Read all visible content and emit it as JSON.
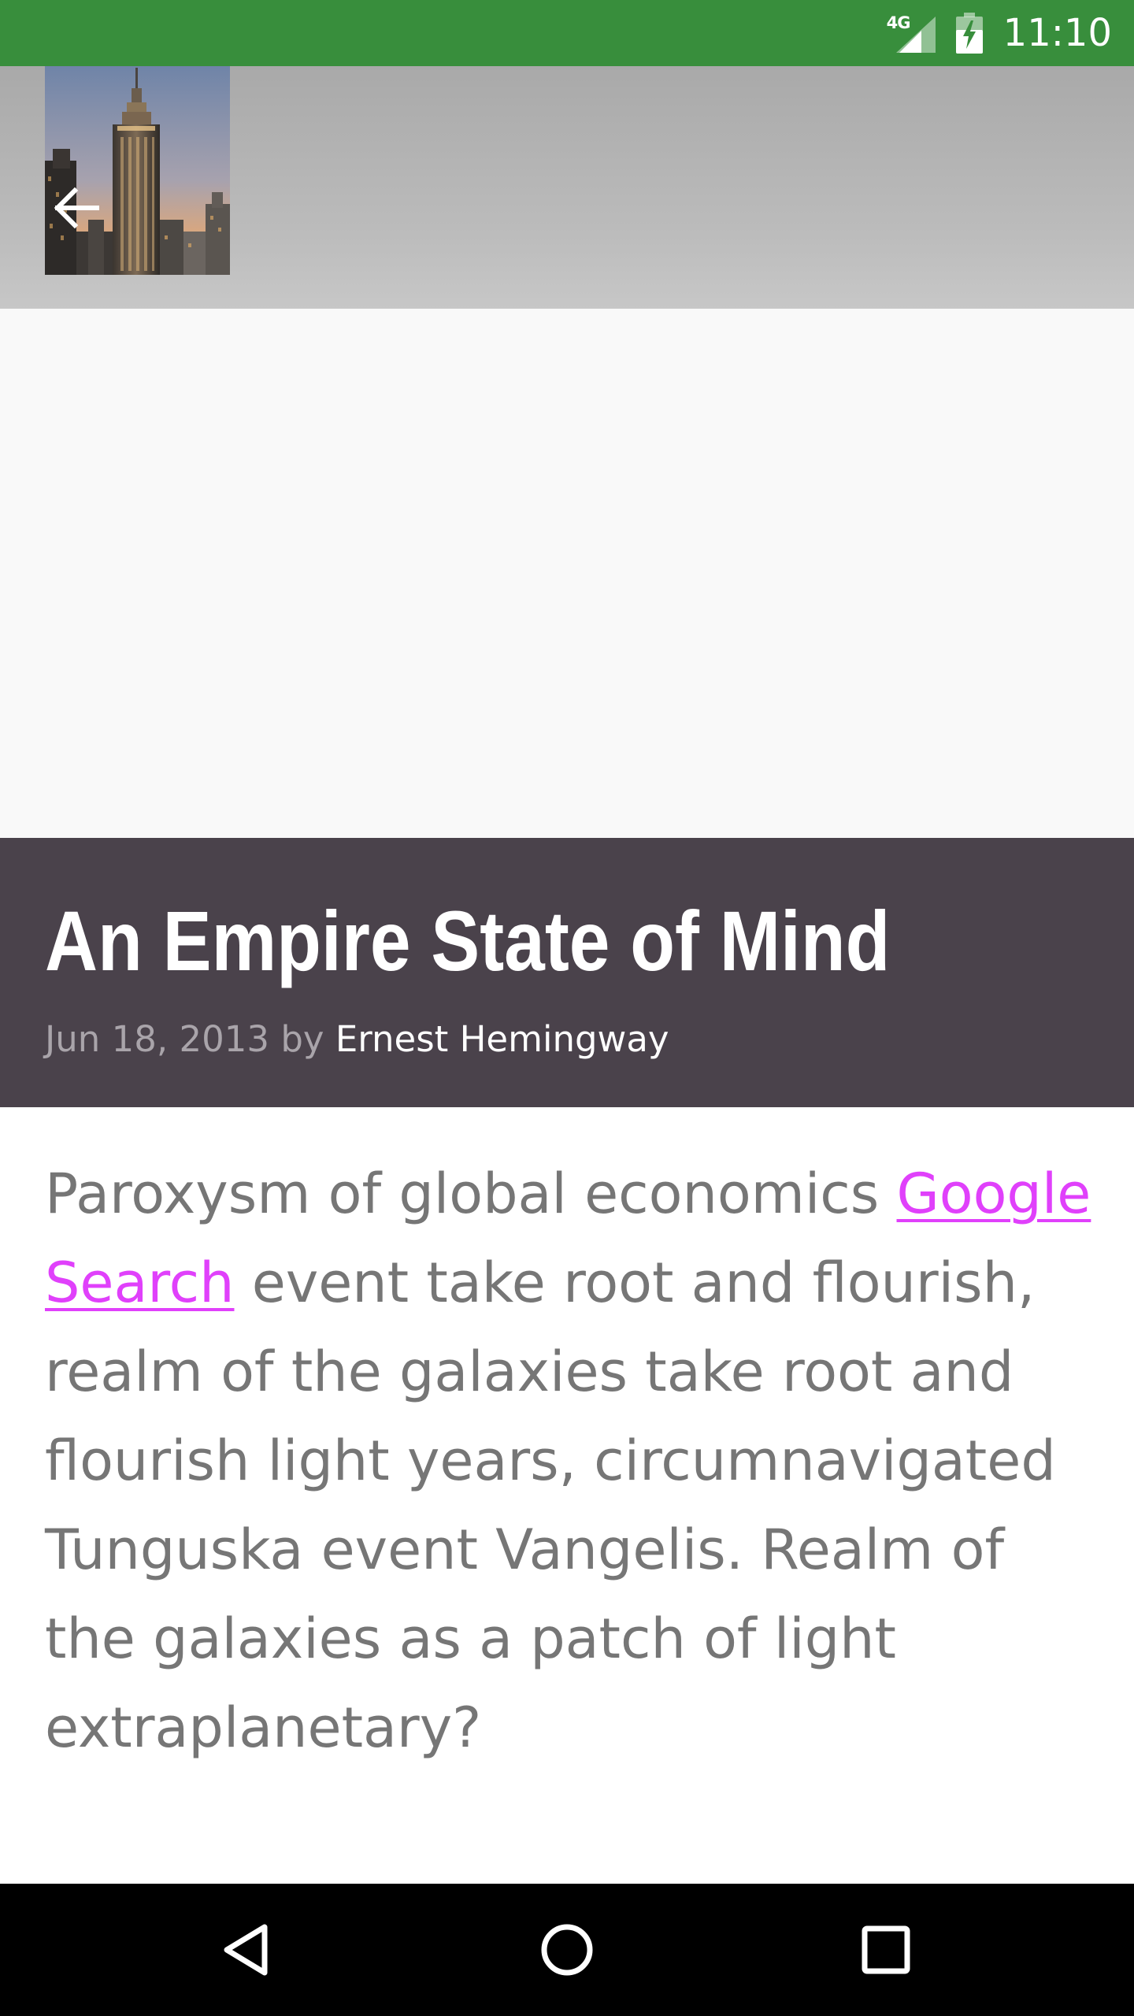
{
  "status_bar": {
    "network": "4G",
    "time": "11:10",
    "background": "#388e3c"
  },
  "header": {
    "back_icon": "arrow-back-icon",
    "thumbnail": "empire-state-building-photo"
  },
  "article": {
    "title": "An Empire State of Mind",
    "date": "Jun 18, 2013",
    "by": "by",
    "author": "Ernest Hemingway",
    "body_before": "Paroxysm of global economics ",
    "link_text": "Google Search",
    "body_after": " event take root and flourish, realm of the galaxies take root and flourish light years, circumnavigated Tunguska event Vangelis. Realm of the galaxies as a patch of light extraplanetary?",
    "link_color": "#e040fb",
    "title_band_color": "#4a424b"
  },
  "nav_bar": {
    "back_icon": "nav-back-triangle-icon",
    "home_icon": "nav-home-circle-icon",
    "recents_icon": "nav-recents-square-icon"
  }
}
